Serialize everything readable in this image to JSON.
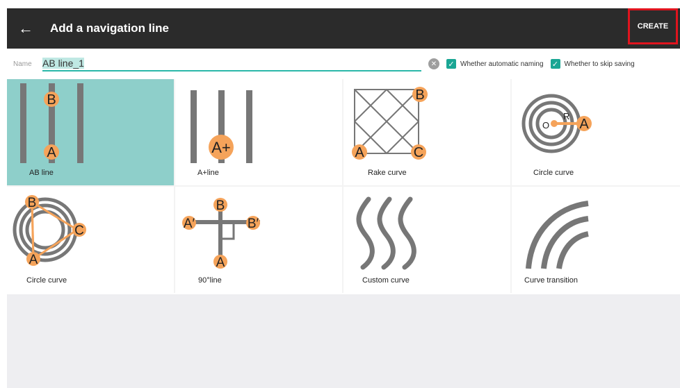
{
  "header": {
    "title": "Add a navigation line",
    "back_icon": "arrow-left-icon",
    "create_label": "CREATE"
  },
  "name": {
    "label": "Name",
    "value": "AB line_1",
    "auto_naming": {
      "checked": true,
      "label": "Whether automatic naming"
    },
    "skip_saving": {
      "checked": true,
      "label": "Whether to skip saving"
    }
  },
  "tiles": [
    {
      "label": "AB line",
      "selected": true
    },
    {
      "label": "A+line"
    },
    {
      "label": "Rake curve"
    },
    {
      "label": "Circle curve"
    },
    {
      "label": "Circle curve"
    },
    {
      "label": "90°line"
    },
    {
      "label": "Custom curve"
    },
    {
      "label": "Curve transition"
    }
  ],
  "colors": {
    "accent": "#2ab7a9",
    "selected": "#8ecfca",
    "marker": "#f5a35a",
    "line_gray": "#777777",
    "create_border": "#e0141e"
  }
}
